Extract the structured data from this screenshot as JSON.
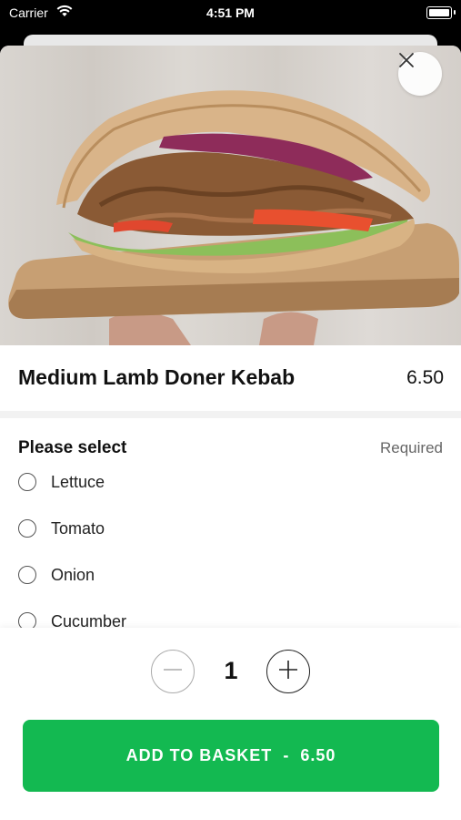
{
  "status_bar": {
    "carrier": "Carrier",
    "time": "4:51 PM"
  },
  "item": {
    "name": "Medium Lamb Doner Kebab",
    "price": "6.50",
    "image": "doner-kebab-photo"
  },
  "options_section": {
    "title": "Please select",
    "required_label": "Required",
    "options": [
      {
        "label": "Lettuce",
        "selected": false
      },
      {
        "label": "Tomato",
        "selected": false
      },
      {
        "label": "Onion",
        "selected": false
      },
      {
        "label": "Cucumber",
        "selected": false
      }
    ]
  },
  "stepper": {
    "quantity": "1",
    "minus_icon": "minus-icon",
    "plus_icon": "plus-icon"
  },
  "add_to_basket": {
    "label": "ADD TO BASKET",
    "separator": "-",
    "price": "6.50"
  },
  "colors": {
    "accent": "#13b951",
    "text": "#111111",
    "muted": "#666666"
  }
}
